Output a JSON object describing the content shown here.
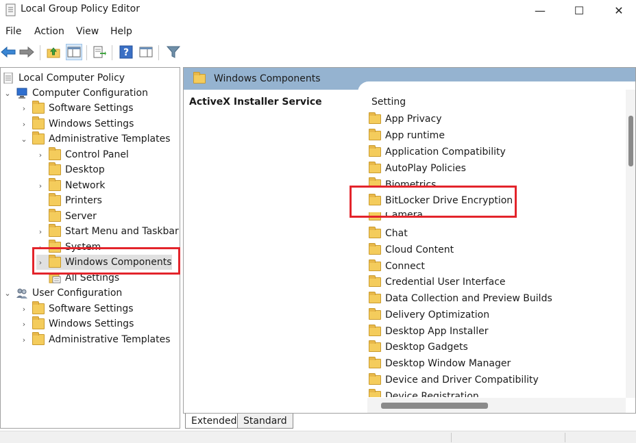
{
  "window": {
    "title": "Local Group Policy Editor",
    "min_glyph": "—",
    "max_glyph": "☐",
    "close_glyph": "✕"
  },
  "menu": {
    "file": "File",
    "action": "Action",
    "view": "View",
    "help": "Help"
  },
  "toolbar": {
    "icons": [
      "back-arrow-icon",
      "forward-arrow-icon",
      "up-folder-icon",
      "show-hide-tree-icon",
      "export-list-icon",
      "help-icon",
      "properties-pane-icon",
      "filter-icon"
    ]
  },
  "tree": {
    "root": "Local Computer Policy",
    "computer_config": "Computer Configuration",
    "cc_software": "Software Settings",
    "cc_windows": "Windows Settings",
    "cc_admin": "Administrative Templates",
    "control_panel": "Control Panel",
    "desktop": "Desktop",
    "network": "Network",
    "printers": "Printers",
    "server": "Server",
    "start_menu": "Start Menu and Taskbar",
    "system": "System",
    "windows_components": "Windows Components",
    "all_settings": "All Settings",
    "user_config": "User Configuration",
    "uc_software": "Software Settings",
    "uc_windows": "Windows Settings",
    "uc_admin": "Administrative Templates"
  },
  "right": {
    "header": "Windows Components",
    "description_title": "ActiveX Installer Service",
    "column_setting": "Setting",
    "items": [
      "App Privacy",
      "App runtime",
      "Application Compatibility",
      "AutoPlay Policies",
      "Biometrics",
      "BitLocker Drive Encryption",
      "Camera",
      "Chat",
      "Cloud Content",
      "Connect",
      "Credential User Interface",
      "Data Collection and Preview Builds",
      "Delivery Optimization",
      "Desktop App Installer",
      "Desktop Gadgets",
      "Desktop Window Manager",
      "Device and Driver Compatibility",
      "Device Registration"
    ]
  },
  "tabs": {
    "extended": "Extended",
    "standard": "Standard"
  },
  "colors": {
    "highlight": "#e3242b",
    "header_band": "#95b3d0",
    "folder": "#f4cc5c"
  }
}
